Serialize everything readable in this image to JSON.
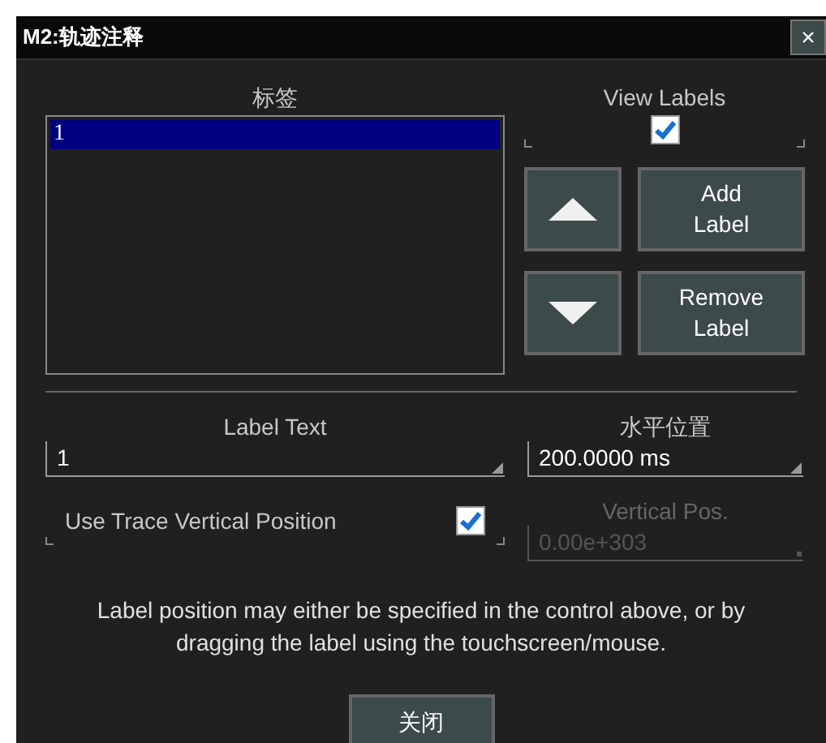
{
  "window": {
    "title": "M2:轨迹注释",
    "close": "×"
  },
  "labels_list": {
    "heading": "标签",
    "items": [
      {
        "text": "1",
        "selected": true
      }
    ]
  },
  "view_labels": {
    "label": "View Labels",
    "checked": true
  },
  "buttons": [
    {
      "kind": "up"
    },
    {
      "kind": "text",
      "label": "Add\nLabel"
    },
    {
      "kind": "down"
    },
    {
      "kind": "text",
      "label": "Remove\nLabel"
    }
  ],
  "fields": [
    {
      "label": "Label Text",
      "value": "1",
      "disabled": false
    },
    {
      "label": "水平位置",
      "value": "200.0000 ms",
      "disabled": false
    }
  ],
  "use_trace_vertical": {
    "label": "Use Trace Vertical Position",
    "checked": true
  },
  "vertical_pos": {
    "label": "Vertical Pos.",
    "value": "0.00e+303",
    "disabled": true
  },
  "note": "Label position may either be specified in the control above, or by dragging the label using the touchscreen/mouse.",
  "close_button": "关闭"
}
